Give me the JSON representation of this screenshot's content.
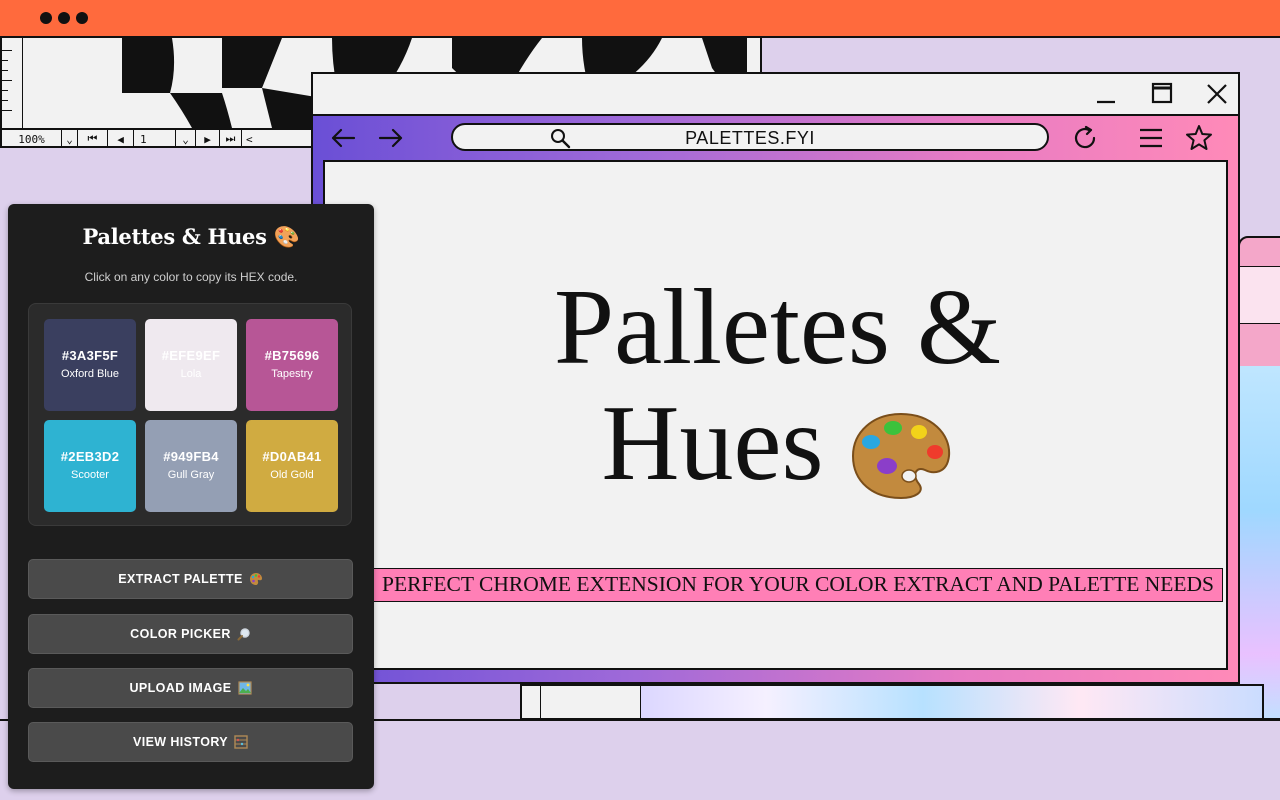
{
  "background_window": {
    "zoom": "100%",
    "page": "1"
  },
  "browser": {
    "url": "PALETTES.FYI",
    "hero_line1": "Palletes &",
    "hero_line2": "Hues",
    "tagline": "PERFECT CHROME EXTENSION FOR YOUR COLOR EXTRACT AND PALETTE NEEDS",
    "icons": [
      "back-arrow-icon",
      "forward-arrow-icon",
      "search-icon",
      "refresh-icon",
      "menu-icon",
      "star-icon",
      "minimize-icon",
      "maximize-icon",
      "close-icon",
      "palette-icon"
    ]
  },
  "popup": {
    "title": "Palettes & Hues 🎨",
    "subtitle": "Click on any color to copy its HEX code.",
    "swatches": [
      {
        "hex": "#3A3F5F",
        "name": "Oxford Blue",
        "color": "#3A3F5F",
        "text_color": "#ffffff"
      },
      {
        "hex": "#EFE9EF",
        "name": "Lola",
        "color": "#EFE9EF",
        "text_color": "#ffffff"
      },
      {
        "hex": "#B75696",
        "name": "Tapestry",
        "color": "#B75696",
        "text_color": "#ffffff"
      },
      {
        "hex": "#2EB3D2",
        "name": "Scooter",
        "color": "#2EB3D2",
        "text_color": "#ffffff"
      },
      {
        "hex": "#949FB4",
        "name": "Gull Gray",
        "color": "#949FB4",
        "text_color": "#ffffff"
      },
      {
        "hex": "#D0AB41",
        "name": "Old Gold",
        "color": "#D0AB41",
        "text_color": "#ffffff"
      }
    ],
    "buttons": {
      "extract": "EXTRACT PALETTE",
      "picker": "COLOR PICKER",
      "upload": "UPLOAD IMAGE",
      "history": "VIEW HISTORY"
    }
  },
  "colors": {
    "top_bar": "#ff6a3d",
    "page_bg": "#ddd0ec",
    "tagline_bg": "#ff7fb6"
  }
}
